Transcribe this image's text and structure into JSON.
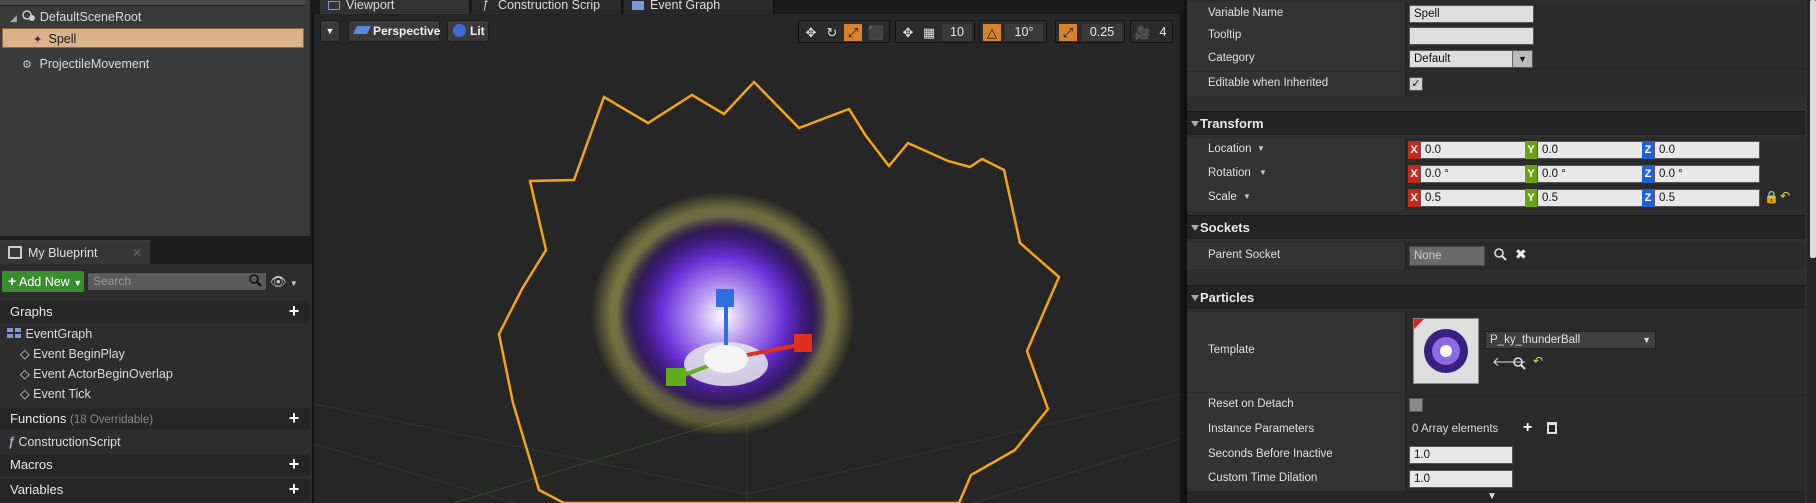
{
  "components": {
    "root": "DefaultSceneRoot",
    "selected": "Spell",
    "movement": "ProjectileMovement"
  },
  "my_blueprint": {
    "tab_label": "My Blueprint",
    "add_new_label": "Add New",
    "search_placeholder": "Search",
    "graphs_header": "Graphs",
    "event_graph": "EventGraph",
    "events": [
      "Event BeginPlay",
      "Event ActorBeginOverlap",
      "Event Tick"
    ],
    "functions_header": "Functions",
    "functions_note": "(18 Overridable)",
    "construction_script": "ConstructionScript",
    "macros_header": "Macros",
    "variables_header": "Variables"
  },
  "editor_tabs": [
    "Viewport",
    "Construction Scrip",
    "Event Graph"
  ],
  "viewport": {
    "perspective_label": "Perspective",
    "lit_label": "Lit",
    "grid_snap": "10",
    "rotation_snap": "10°",
    "scale_snap": "0.25",
    "camera_speed": "4",
    "colors": {
      "bounds": "#f2a51a",
      "accent": "#d9822b",
      "orb": "#6a30d8"
    }
  },
  "details": {
    "variable_name_label": "Variable Name",
    "variable_name": "Spell",
    "tooltip_label": "Tooltip",
    "tooltip": "",
    "category_label": "Category",
    "category": "Default",
    "editable_label": "Editable when Inherited",
    "editable_checked": true,
    "transform_header": "Transform",
    "location_label": "Location",
    "rotation_label": "Rotation",
    "scale_label": "Scale",
    "location": {
      "x": "0.0",
      "y": "0.0",
      "z": "0.0"
    },
    "rotation": {
      "x": "0.0 °",
      "y": "0.0 °",
      "z": "0.0 °"
    },
    "scale": {
      "x": "0.5",
      "y": "0.5",
      "z": "0.5"
    },
    "sockets_header": "Sockets",
    "parent_socket_label": "Parent Socket",
    "parent_socket": "None",
    "particles_header": "Particles",
    "template_label": "Template",
    "template": "P_ky_thunderBall",
    "reset_on_detach_label": "Reset on Detach",
    "instance_params_label": "Instance Parameters",
    "instance_params_value": "0 Array elements",
    "seconds_inactive_label": "Seconds Before Inactive",
    "seconds_inactive": "1.0",
    "time_dilation_label": "Custom Time Dilation",
    "time_dilation": "1.0",
    "axis_x": "X",
    "axis_y": "Y",
    "axis_z": "Z",
    "axis_colors": {
      "x": "#c8281c",
      "y": "#6aa312",
      "z": "#2060d8"
    }
  }
}
